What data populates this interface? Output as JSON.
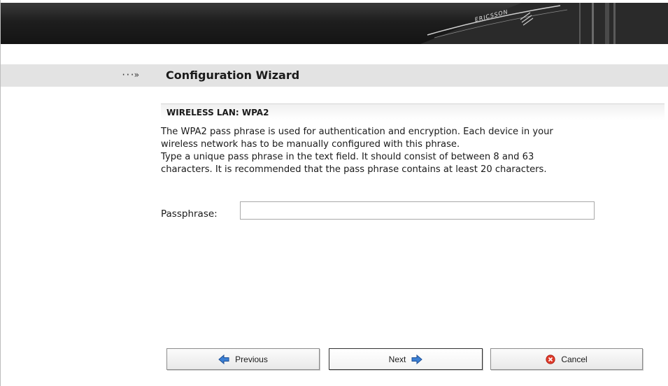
{
  "header": {
    "brand": "ERICSSON"
  },
  "title_bar": {
    "arrow": "···»",
    "title": "Configuration Wizard"
  },
  "section": {
    "title": "WIRELESS LAN: WPA2",
    "description_lines": [
      "The WPA2 pass phrase is used for authentication and encryption. Each device in your",
      "wireless network has to be manually configured with this phrase.",
      "Type a unique pass phrase in the text field. It should consist of between 8 and 63",
      "characters. It is recommended that the pass phrase contains at least 20 characters."
    ]
  },
  "form": {
    "passphrase_label": "Passphrase:",
    "passphrase_value": ""
  },
  "buttons": {
    "previous": "Previous",
    "next": "Next",
    "cancel": "Cancel"
  },
  "icons": {
    "previous": "left-arrow-icon",
    "next": "right-arrow-icon",
    "cancel": "cancel-icon"
  },
  "colors": {
    "arrow_icon_fill": "#3b7fd4",
    "cancel_icon_fill": "#e03a2a",
    "title_bar_bg": "#e3e3e3",
    "banner_bg": "#1e1e1e"
  }
}
